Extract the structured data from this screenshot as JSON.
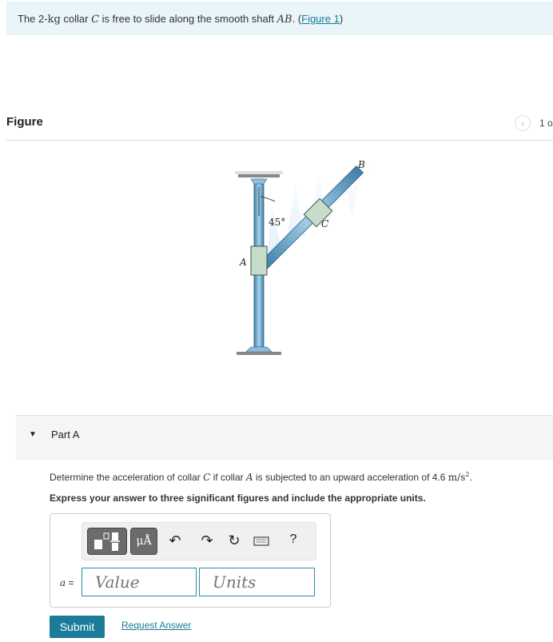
{
  "intro": {
    "prefix": "The 2-",
    "mass_unit": "kg",
    "mid1": " collar ",
    "collar": "C",
    "mid2": " is free to slide along the smooth shaft ",
    "shaft": "AB",
    "mid3": ". (",
    "figure_link": "Figure 1",
    "suffix": ")"
  },
  "figure": {
    "header": "Figure",
    "page_indicator": "1 o",
    "prev_icon": "chevron-left-icon",
    "labels": {
      "A": "A",
      "B": "B",
      "C": "C",
      "angle": "45°"
    }
  },
  "part": {
    "title": "Part A",
    "question": {
      "t1": "Determine the acceleration of collar ",
      "c": "C",
      "t2": " if collar ",
      "a": "A",
      "t3": " is subjected to an upward acceleration of 4.6 ",
      "unit": "m/s",
      "exp": "2",
      "t4": "."
    },
    "instruction": "Express your answer to three significant figures and include the appropriate units."
  },
  "toolbar": {
    "templates_icon": "templates-icon",
    "units_label": "μÅ",
    "undo_icon": "↶",
    "redo_icon": "↷",
    "reset_icon": "↻",
    "keyboard_icon": "keyboard-icon",
    "help_label": "?"
  },
  "answer": {
    "variable": "a",
    "equals": " =",
    "value_placeholder": "Value",
    "units_placeholder": "Units"
  },
  "actions": {
    "submit": "Submit",
    "request_answer": "Request Answer"
  }
}
